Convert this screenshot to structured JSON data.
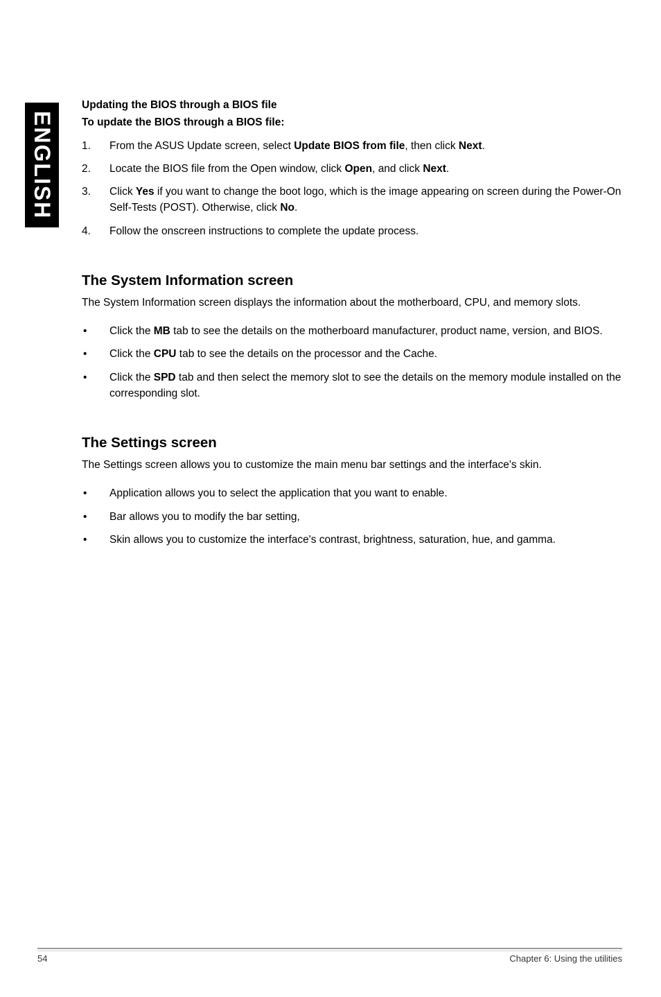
{
  "sideTab": "ENGLISH",
  "section1": {
    "heading1": "Updating the BIOS through a BIOS file",
    "heading2": "To update the BIOS through a BIOS file:",
    "items": [
      {
        "num": "1.",
        "pre": "From the ASUS Update screen, select ",
        "b1": "Update BIOS from file",
        "mid": ", then click ",
        "b2": "Next",
        "post": "."
      },
      {
        "num": "2.",
        "pre": "Locate the BIOS file from the Open window, click ",
        "b1": "Open",
        "mid": ", and click ",
        "b2": "Next",
        "post": "."
      },
      {
        "num": "3.",
        "pre": "Click ",
        "b1": "Yes",
        "mid": " if you want to change the boot logo, which is the image appearing on screen during the Power-On Self-Tests (POST). Otherwise, click ",
        "b2": "No",
        "post": "."
      },
      {
        "num": "4.",
        "pre": "Follow the onscreen instructions to complete the update process.",
        "b1": "",
        "mid": "",
        "b2": "",
        "post": ""
      }
    ]
  },
  "section2": {
    "heading": "The System Information screen",
    "body": "The System Information screen displays the information about the motherboard, CPU, and memory slots.",
    "items": [
      {
        "pre": "Click the ",
        "b": "MB",
        "post": " tab to see the details on the motherboard manufacturer, product name, version, and BIOS."
      },
      {
        "pre": "Click the ",
        "b": "CPU",
        "post": " tab to see the details on the processor and the Cache."
      },
      {
        "pre": "Click the ",
        "b": "SPD",
        "post": " tab and then select the memory slot to see the details on the memory module installed on the corresponding slot."
      }
    ]
  },
  "section3": {
    "heading": "The Settings screen",
    "body": "The Settings screen allows you to customize the main menu bar settings and the interface's skin.",
    "items": [
      {
        "text": "Application allows you to select the application that you want to enable."
      },
      {
        "text": "Bar allows you to modify the bar setting,"
      },
      {
        "text": "Skin allows you to customize the interface's contrast, brightness, saturation, hue, and gamma."
      }
    ]
  },
  "footer": {
    "pageNum": "54",
    "chapter": "Chapter 6: Using the utilities"
  }
}
